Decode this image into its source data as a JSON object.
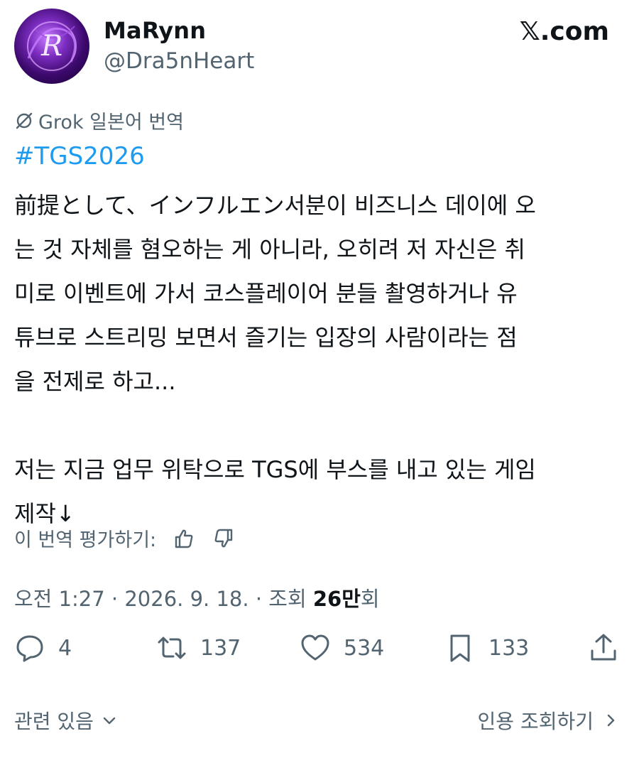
{
  "author": {
    "name": "MaRynn",
    "handle": "@Dra5nHeart"
  },
  "brand": "𝕏.com",
  "translation": {
    "label": "Grok 일본어 번역"
  },
  "post": {
    "hashtag": "#TGS2026",
    "body": "前提として、インフルエン서분이 비즈니스 데이에 오\n는 것 자체를 혐오하는 게 아니라, 오히려 저 자신은 취\n미로 이벤트에 가서 코스플레이어 분들 촬영하거나 유\n튜브로 스트리밍 보면서 즐기는 입장의 사람이라는 점\n을 전제로 하고...\n\n저는 지금 업무 위탁으로 TGS에 부스를 내고 있는 게임\n제작↓"
  },
  "rating": {
    "label": "이 번역 평가하기:"
  },
  "meta": {
    "time": "오전 1:27",
    "date": "2026. 9. 18.",
    "views_prefix": "조회",
    "views_count": "26만",
    "views_suffix": "회",
    "separator": "·"
  },
  "actions": {
    "replies": "4",
    "reposts": "137",
    "likes": "534",
    "bookmarks": "133"
  },
  "footer": {
    "related": "관련 있음",
    "quotes": "인용 조회하기"
  }
}
